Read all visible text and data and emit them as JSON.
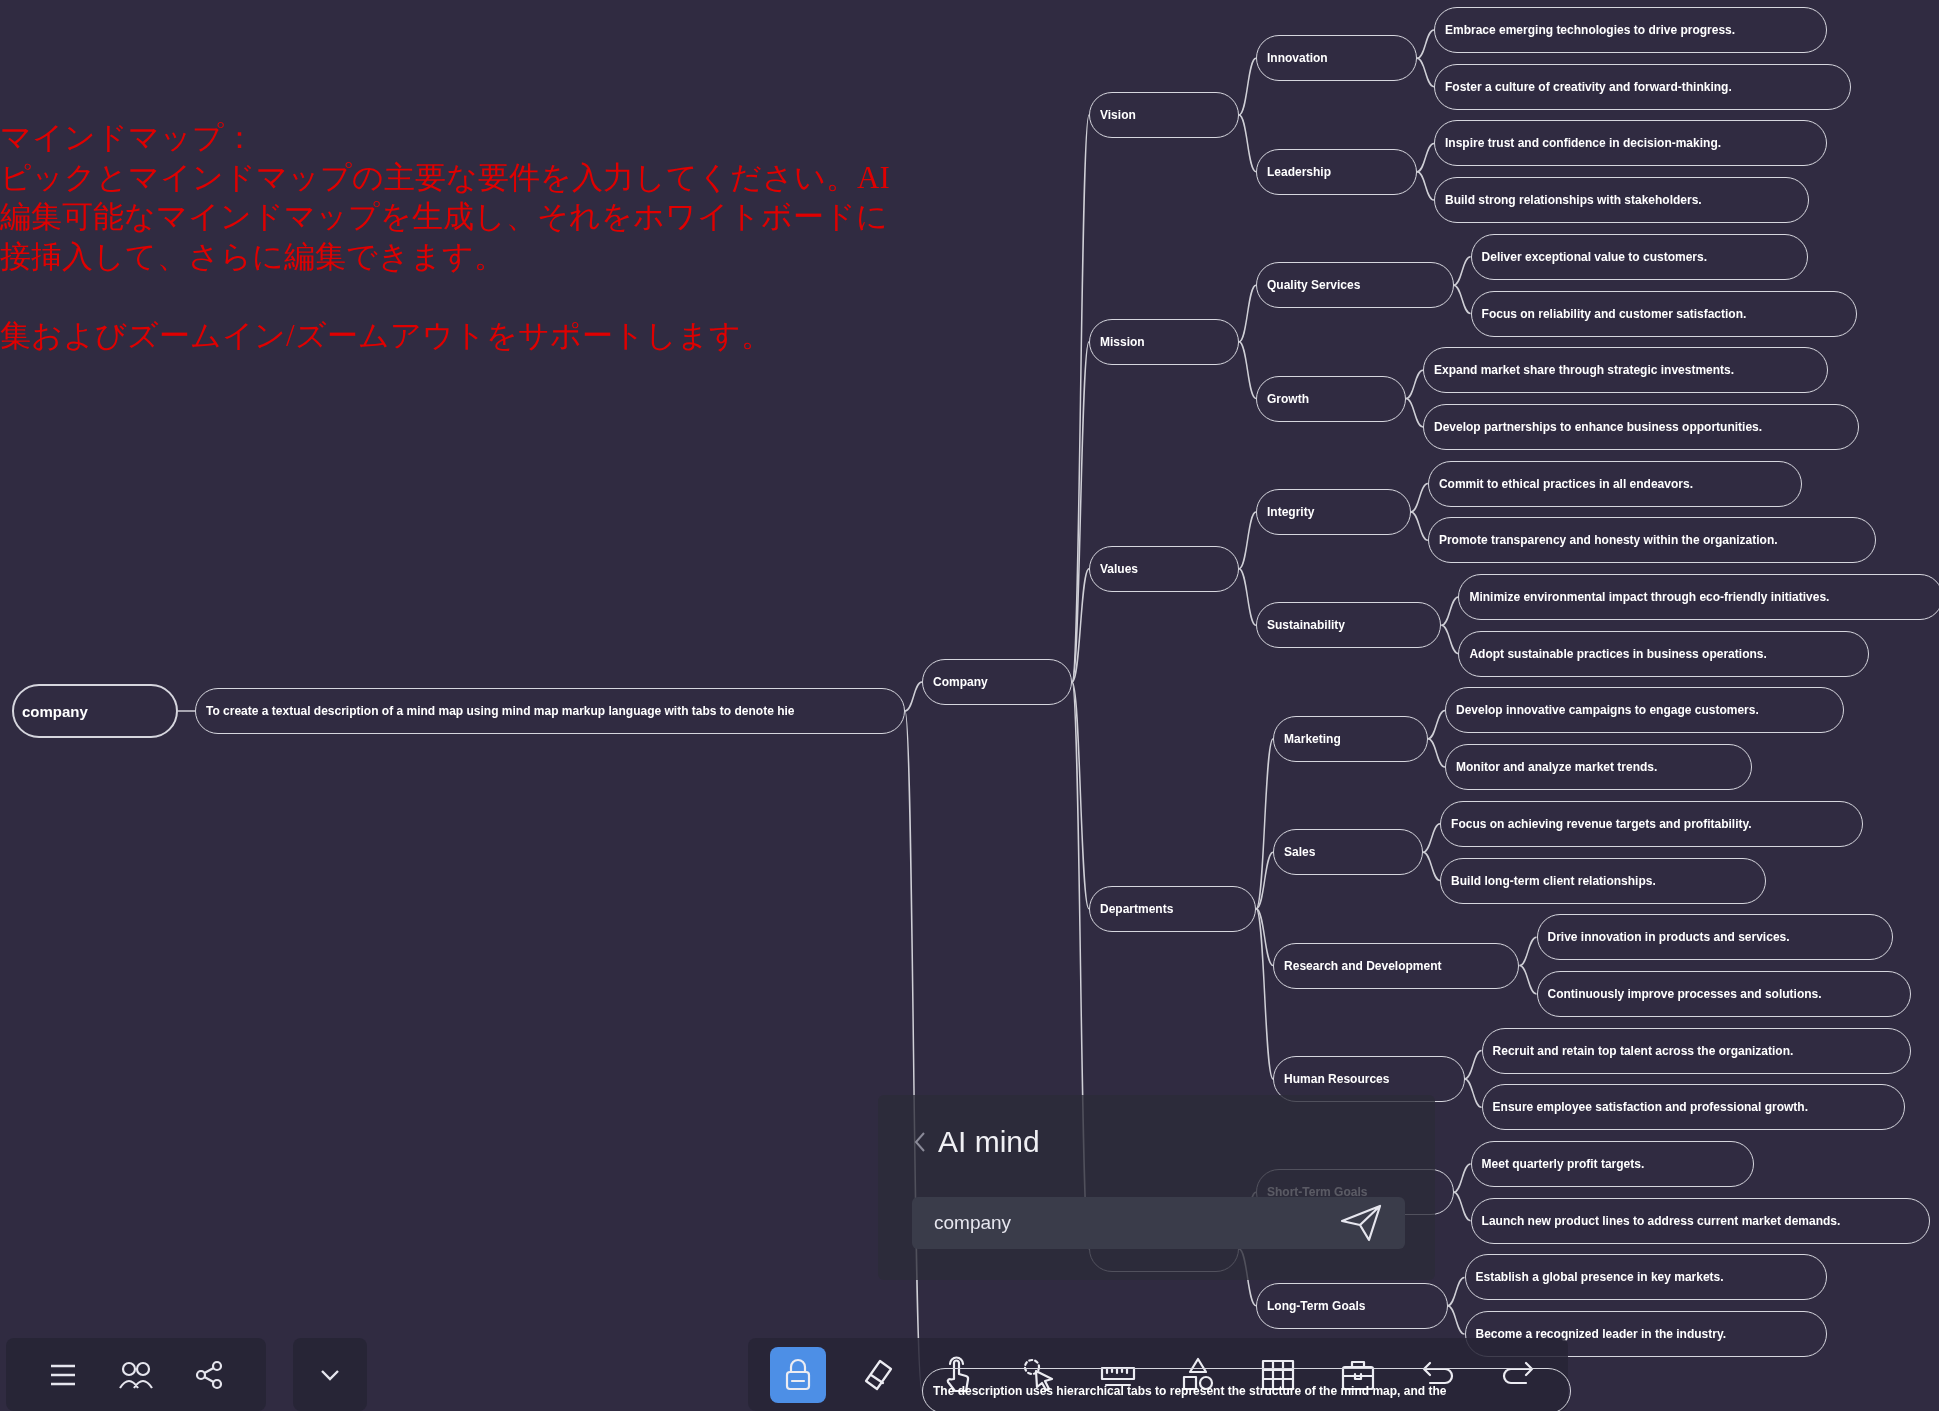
{
  "intro_paragraphs": [
    {
      "lines": [
        "マインドマップ：",
        "ピックとマインドマップの主要な要件を入力してください。AI",
        "編集可能なマインドマップを生成し、それをホワイトボードに",
        "接挿入して、さらに編集できます。"
      ]
    },
    {
      "lines": [
        "集およびズームイン/ズームアウトをサポートします。"
      ]
    }
  ],
  "mind_map": {
    "root": {
      "label": "company",
      "children": [
        {
          "label": "To create a textual description of a mind map using mind map markup language with tabs to denote hie",
          "children": [
            {
              "label": "Company",
              "children": [
                {
                  "label": "Vision",
                  "children": [
                    {
                      "label": "Innovation",
                      "children": [
                        {
                          "label": "Embrace emerging technologies to drive progress."
                        },
                        {
                          "label": "Foster a culture of creativity and forward-thinking."
                        }
                      ]
                    },
                    {
                      "label": "Leadership",
                      "children": [
                        {
                          "label": "Inspire trust and confidence in decision-making."
                        },
                        {
                          "label": "Build strong relationships with stakeholders."
                        }
                      ]
                    }
                  ]
                },
                {
                  "label": "Mission",
                  "children": [
                    {
                      "label": "Quality Services",
                      "children": [
                        {
                          "label": "Deliver exceptional value to customers."
                        },
                        {
                          "label": "Focus on reliability and customer satisfaction."
                        }
                      ]
                    },
                    {
                      "label": "Growth",
                      "children": [
                        {
                          "label": "Expand market share through strategic investments."
                        },
                        {
                          "label": "Develop partnerships to enhance business opportunities."
                        }
                      ]
                    }
                  ]
                },
                {
                  "label": "Values",
                  "children": [
                    {
                      "label": "Integrity",
                      "children": [
                        {
                          "label": "Commit to ethical practices in all endeavors."
                        },
                        {
                          "label": "Promote transparency and honesty within the organization."
                        }
                      ]
                    },
                    {
                      "label": "Sustainability",
                      "children": [
                        {
                          "label": "Minimize environmental impact through eco-friendly initiatives."
                        },
                        {
                          "label": "Adopt sustainable practices in business operations."
                        }
                      ]
                    }
                  ]
                },
                {
                  "label": "Departments",
                  "children": [
                    {
                      "label": "Marketing",
                      "children": [
                        {
                          "label": "Develop innovative campaigns to engage customers."
                        },
                        {
                          "label": "Monitor and analyze market trends."
                        }
                      ]
                    },
                    {
                      "label": "Sales",
                      "children": [
                        {
                          "label": "Focus on achieving revenue targets and profitability."
                        },
                        {
                          "label": "Build long-term client relationships."
                        }
                      ]
                    },
                    {
                      "label": "Research and Development",
                      "children": [
                        {
                          "label": "Drive innovation in products and services."
                        },
                        {
                          "label": "Continuously improve processes and solutions."
                        }
                      ]
                    },
                    {
                      "label": "Human Resources",
                      "children": [
                        {
                          "label": "Recruit and retain top talent across the organization."
                        },
                        {
                          "label": "Ensure employee satisfaction and professional growth."
                        }
                      ]
                    }
                  ]
                },
                {
                  "children": [
                    {
                      "label": "Short-Term Goals",
                      "children": [
                        {
                          "label": "Meet quarterly profit targets."
                        },
                        {
                          "label": "Launch new product lines to address current market demands."
                        }
                      ]
                    },
                    {
                      "label": "Long-Term Goals",
                      "children": [
                        {
                          "label": "Establish a global presence in key markets."
                        },
                        {
                          "label": "Become a recognized leader in the industry."
                        }
                      ]
                    }
                  ]
                }
              ]
            },
            {
              "label": "The description uses hierarchical tabs to represent the structure of the mind map, and the"
            }
          ]
        }
      ]
    }
  },
  "ai_panel": {
    "title": "AI mind",
    "input": {
      "value": "company"
    }
  },
  "main_toolbar": {
    "tools": [
      {
        "selected": true
      },
      {
        "selected": false
      },
      {
        "selected": false
      },
      {
        "selected": false
      },
      {
        "selected": false
      },
      {
        "selected": false
      },
      {
        "selected": false
      },
      {
        "selected": false
      },
      {
        "selected": false
      },
      {
        "selected": false
      }
    ]
  }
}
